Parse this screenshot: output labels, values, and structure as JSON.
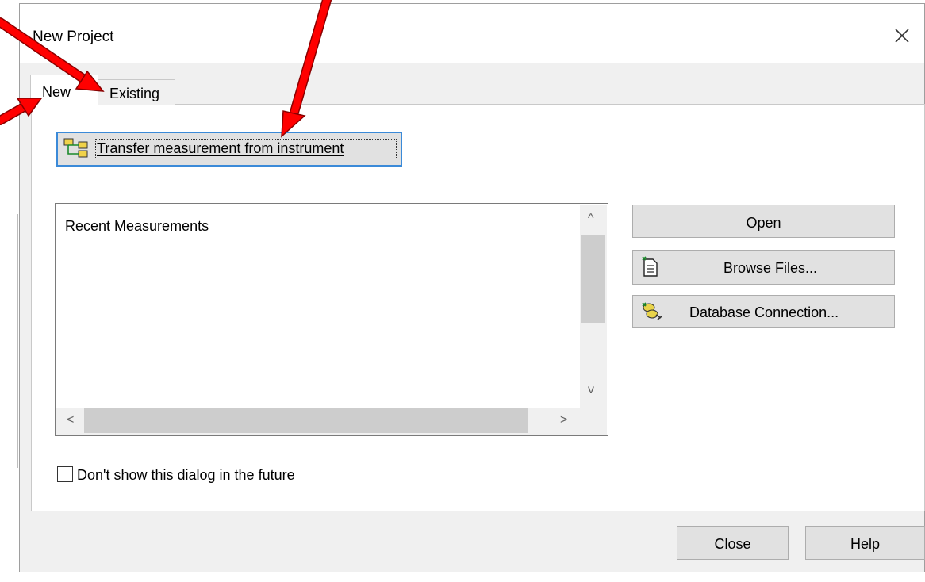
{
  "dialog": {
    "title": "New Project",
    "close_glyph": "close-icon"
  },
  "tabs": [
    {
      "label": "New",
      "active": true
    },
    {
      "label": "Existing",
      "active": false
    }
  ],
  "transfer": {
    "label": "Transfer measurement from instrument",
    "icon": "instrument-tree-icon"
  },
  "recent": {
    "header": "Recent Measurements",
    "items": [],
    "scroll_up_glyph": "^",
    "scroll_down_glyph": "v",
    "scroll_left_glyph": "<",
    "scroll_right_glyph": ">"
  },
  "actions": {
    "open_label": "Open",
    "browse_label": "Browse Files...",
    "browse_icon": "document-icon",
    "database_label": "Database Connection...",
    "database_icon": "database-plug-icon"
  },
  "options": {
    "dont_show_label": "Don't show this dialog in the future",
    "dont_show_checked": false
  },
  "footer": {
    "close_label": "Close",
    "help_label": "Help"
  },
  "colors": {
    "focus_border": "#3b8ad8",
    "annotation_arrow": "#ff0000",
    "dialog_bg": "#f0f0f0"
  }
}
